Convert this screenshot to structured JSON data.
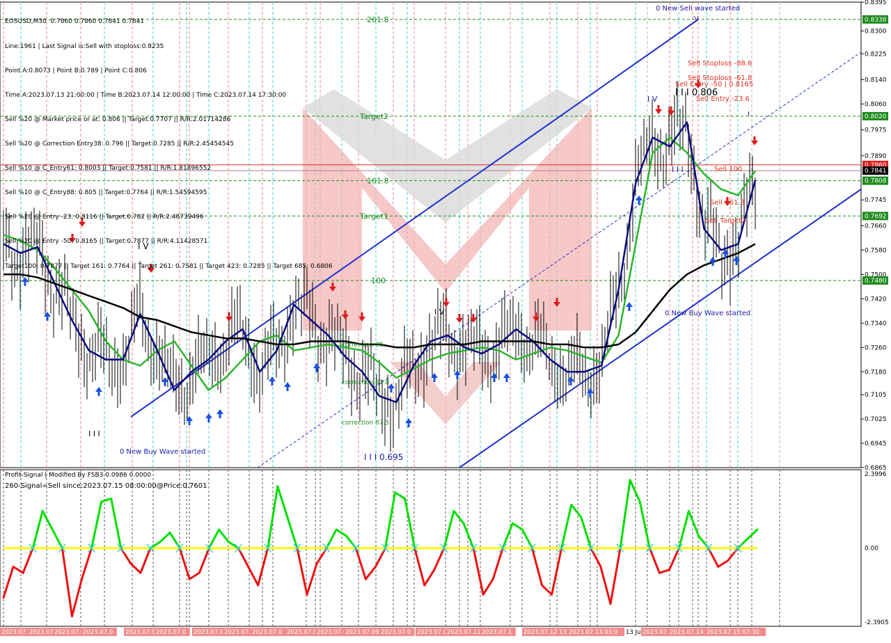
{
  "header": {
    "lines": [
      "EOSUSD,M30  0.7860 0.7860 0.7841 0.7841",
      "Line:1961 | Last Signal is:Sell with stoploss:0.8235",
      "Point A:0.8073 | Point B:0.789 | Point C:0.806",
      "Time A:2023.07.13 21:00:00 | Time B:2023.07.14 12:00:00 | Time C:2023.07.14 17:30:00",
      "Sell %20 @ Market price or at: 0.806 || Target:0.7707 || R/R:2.01714286",
      "Sell %20 @ Correction Entry38: 0.796 || Target:0.7285 || R/R:2.45454545",
      "Sell %10 @ C_Entry61: 0.8003 || Target:0.7581 || R/R:1.81896552",
      "Sell %10 @ C_Entry88: 0.805 || Target:0.7764 || R/R:1.54594595",
      "Sell %20 @ Entry -23: 0.8116 || Target:0.782 || R/R:2.48739496",
      "Sell %20 @ Entry -50: 0.8165 || Target:0.7877 || R/R:4.11428571",
      "Target100: 0.7877 || Target 161: 0.7764 || Target 261: 0.7581 || Target 423: 0.7285 || Target 685: 0.6806"
    ]
  },
  "chart_data": [
    {
      "type": "line",
      "symbol": "EOSUSD",
      "timeframe": "M30",
      "ohlc_last": {
        "open": 0.786,
        "high": 0.786,
        "low": 0.7841,
        "close": 0.7841
      },
      "ylim": [
        0.6865,
        0.8395
      ],
      "y_ticks": [
        "0.8395",
        "0.8300",
        "0.8225",
        "0.8140",
        "0.8060",
        "0.7975",
        "0.7890",
        "0.7745",
        "0.7660",
        "0.7580",
        "0.7500",
        "0.7420",
        "0.7340",
        "0.7260",
        "0.7180",
        "0.7105",
        "0.7025",
        "0.6945",
        "0.6865"
      ],
      "price_labels": [
        {
          "label": "0.8338",
          "value": 0.8338,
          "color": "#1e8c1e"
        },
        {
          "label": "0.8020",
          "value": 0.802,
          "color": "#1e8c1e"
        },
        {
          "label": "0.7860",
          "value": 0.786,
          "color": "#e02020"
        },
        {
          "label": "0.7841",
          "value": 0.7841,
          "color": "#000000"
        },
        {
          "label": "0.7808",
          "value": 0.7808,
          "color": "#1e8c1e"
        },
        {
          "label": "0.7692",
          "value": 0.7692,
          "color": "#1e8c1e"
        },
        {
          "label": "0.7480",
          "value": 0.748,
          "color": "#1e8c1e"
        }
      ],
      "fib_levels": [
        {
          "label": "261.8",
          "value": 0.8338
        },
        {
          "label": "Target2",
          "value": 0.802
        },
        {
          "label": "161.8",
          "value": 0.7808
        },
        {
          "label": "Target1",
          "value": 0.7692
        },
        {
          "label": "100",
          "value": 0.748
        }
      ],
      "annotations": [
        {
          "text": "0 New Sell wave started",
          "color": "#1a1aa8"
        },
        {
          "text": "Sell Stoploss -88.6",
          "color": "#e03020"
        },
        {
          "text": "Sell Stoploss -61.8",
          "color": "#e03020"
        },
        {
          "text": "Sell Entry -50 | 0.8165",
          "color": "#e03020"
        },
        {
          "text": "I I I 0.806",
          "color": "#000000"
        },
        {
          "text": "Sell Entry -23.6",
          "color": "#e03020"
        },
        {
          "text": "Sell 100",
          "color": "#e03020"
        },
        {
          "text": "Sell 161.8",
          "color": "#e03020"
        },
        {
          "text": "Sell Target2",
          "color": "#e03020"
        },
        {
          "text": "0 New Buy Wave started",
          "color": "#1a1aa8"
        },
        {
          "text": "0 New Buy Wave started",
          "color": "#1a1aa8"
        },
        {
          "text": "correction 38",
          "color": "#1e8c1e"
        },
        {
          "text": "correction 61.8",
          "color": "#1e8c1e"
        },
        {
          "text": "correction 87.5",
          "color": "#1e8c1e"
        },
        {
          "text": "I I I 0.695",
          "color": "#1a1aa8"
        },
        {
          "text": "I V",
          "color": "#000000"
        },
        {
          "text": "I I I",
          "color": "#000000"
        },
        {
          "text": "I V",
          "color": "#000000"
        },
        {
          "text": "I I I",
          "color": "#1a1aa8"
        },
        {
          "text": "I V",
          "color": "#1a1aa8"
        },
        {
          "text": "V",
          "color": "#1a1aa8"
        },
        {
          "text": "I",
          "color": "#1a1aa8"
        }
      ],
      "series": [
        {
          "name": "",
          "color": "#2bb52b",
          "values": [
            0.763,
            0.761,
            0.758,
            0.752,
            0.745,
            0.738,
            0.728,
            0.722,
            0.72,
            0.725,
            0.728,
            0.72,
            0.712,
            0.716,
            0.722,
            0.728,
            0.73,
            0.725,
            0.726,
            0.727,
            0.726,
            0.725,
            0.721,
            0.716,
            0.719,
            0.722,
            0.724,
            0.725,
            0.726,
            0.725,
            0.722,
            0.724,
            0.726,
            0.725,
            0.723,
            0.721,
            0.73,
            0.76,
            0.79,
            0.795,
            0.79,
            0.783,
            0.778,
            0.776,
            0.784
          ]
        },
        {
          "name": "",
          "color": "#0a0a80",
          "values": [
            0.76,
            0.757,
            0.759,
            0.747,
            0.735,
            0.725,
            0.722,
            0.722,
            0.737,
            0.725,
            0.712,
            0.718,
            0.722,
            0.728,
            0.732,
            0.718,
            0.725,
            0.74,
            0.735,
            0.73,
            0.723,
            0.718,
            0.71,
            0.708,
            0.72,
            0.728,
            0.73,
            0.726,
            0.724,
            0.727,
            0.732,
            0.728,
            0.722,
            0.718,
            0.718,
            0.72,
            0.745,
            0.78,
            0.795,
            0.792,
            0.8,
            0.765,
            0.758,
            0.76,
            0.781
          ]
        },
        {
          "name": "",
          "color": "#000000",
          "values": [
            0.75,
            0.75,
            0.749,
            0.747,
            0.745,
            0.743,
            0.741,
            0.739,
            0.736,
            0.735,
            0.733,
            0.731,
            0.73,
            0.729,
            0.729,
            0.728,
            0.727,
            0.727,
            0.728,
            0.728,
            0.728,
            0.727,
            0.727,
            0.726,
            0.726,
            0.727,
            0.727,
            0.727,
            0.728,
            0.728,
            0.728,
            0.728,
            0.727,
            0.727,
            0.726,
            0.726,
            0.727,
            0.731,
            0.738,
            0.745,
            0.75,
            0.753,
            0.755,
            0.757,
            0.76
          ]
        }
      ]
    },
    {
      "type": "line",
      "title": "Profit-Signal | Modified By FSB3 0.0986 0.0000",
      "subtitle": "260-Signal=Sell since:2023.07.15 08:00:00@Price:0.7601",
      "ylim": [
        -2.3905,
        2.3996
      ],
      "y_ticks": [
        "2.3996",
        "0.00",
        "-2.3905"
      ],
      "zero_line_color": "#ffff00",
      "above_color": "#00e000",
      "below_color": "#ee1111",
      "values": [
        -1.6,
        -0.6,
        -0.8,
        0.0,
        1.2,
        0.6,
        0.0,
        -2.2,
        -1.0,
        0.0,
        1.5,
        1.6,
        0.0,
        -0.5,
        -0.8,
        0.0,
        0.2,
        0.5,
        0.0,
        -1.0,
        -0.8,
        0.0,
        0.6,
        0.2,
        0.0,
        -0.6,
        -1.2,
        0.0,
        2.0,
        1.0,
        0.0,
        -1.5,
        -0.5,
        0.0,
        0.6,
        0.4,
        0.0,
        -1.0,
        -0.6,
        0.0,
        1.8,
        1.6,
        0.0,
        -1.2,
        -0.7,
        0.0,
        1.2,
        0.8,
        0.0,
        -1.5,
        -1.0,
        0.0,
        0.8,
        0.6,
        0.0,
        -1.2,
        -1.5,
        0.0,
        1.4,
        1.0,
        0.0,
        -0.6,
        -1.8,
        0.0,
        2.2,
        1.5,
        0.0,
        -0.8,
        -0.7,
        0.0,
        1.2,
        0.4,
        0.0,
        -0.6,
        -0.4,
        0.0,
        0.3,
        0.6
      ]
    }
  ],
  "time_axis": {
    "labels": [
      "2023.07.0",
      "2023.07.0",
      "2023.07.0",
      "2023.07.0",
      "2023.07.0",
      "2023.07.0",
      "2023.07.0",
      "2023.07.0",
      "2023.07.0",
      "2023.07.0",
      "2023.07.0",
      "2023.07.09",
      "2023.07.0",
      "2023.07.0",
      "2023.07.11 0",
      "2023.07.1",
      "2023.07.12 13:0",
      "2023.07.13 03:0",
      "13 Jul",
      "2023.07.1",
      "2023.07.14",
      "2023.07.15 07:30"
    ]
  },
  "colors": {
    "red_vline": "#f08080",
    "cyan_vline": "#40d0d0",
    "grey_vline": "#b4b4b4",
    "channel": "#1f2fd0",
    "fib_green": "#1e8c1e",
    "sell_arrow": "#e01818",
    "buy_arrow": "#1a4fe0"
  }
}
